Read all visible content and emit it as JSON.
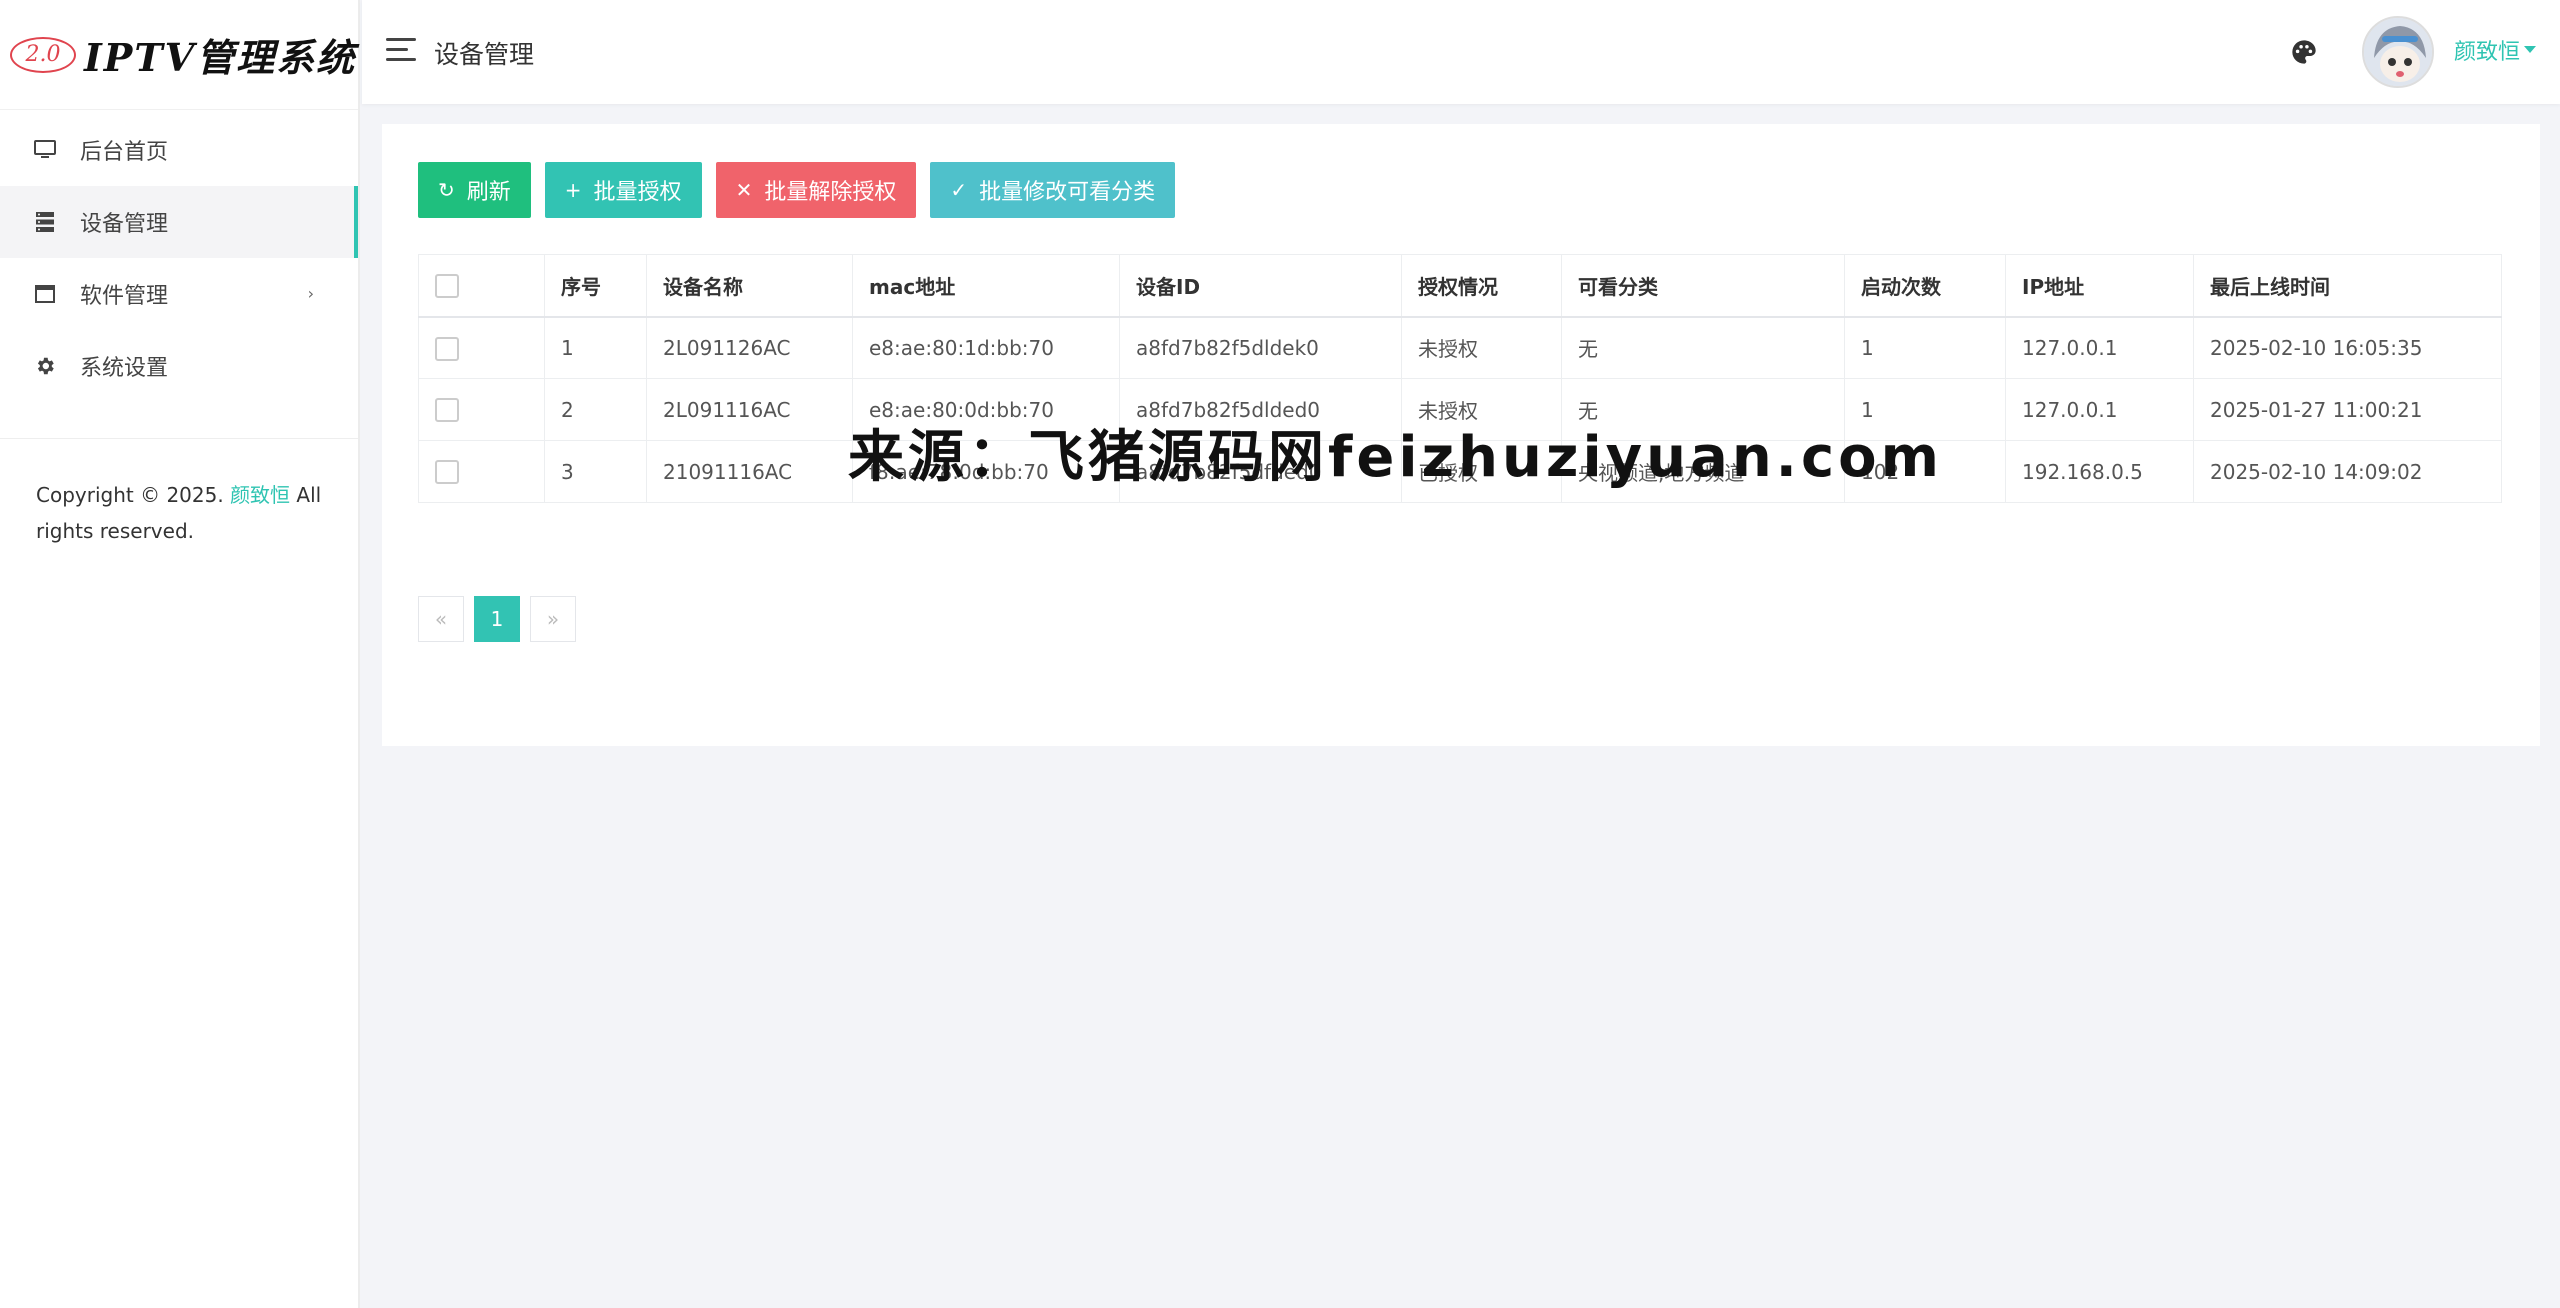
{
  "brand": {
    "badge": "2.0",
    "title": "IPTV管理系统"
  },
  "sidebar": {
    "items": [
      {
        "label": "后台首页",
        "icon": "monitor-icon"
      },
      {
        "label": "设备管理",
        "icon": "server-icon",
        "active": true
      },
      {
        "label": "软件管理",
        "icon": "window-icon",
        "chevron": "›"
      },
      {
        "label": "系统设置",
        "icon": "gear-icon"
      }
    ],
    "copyright_prefix": "Copyright © 2025. ",
    "copyright_author": "颜致恒",
    "copyright_suffix": " All rights reserved."
  },
  "header": {
    "page_title": "设备管理",
    "username": "颜致恒"
  },
  "toolbar": {
    "refresh": {
      "icon": "↻",
      "label": "刷新"
    },
    "batch_auth": {
      "icon": "+",
      "label": "批量授权"
    },
    "batch_unauth": {
      "icon": "✕",
      "label": "批量解除授权"
    },
    "batch_category": {
      "icon": "✓",
      "label": "批量修改可看分类"
    }
  },
  "table": {
    "columns": [
      "序号",
      "设备名称",
      "mac地址",
      "设备ID",
      "授权情况",
      "可看分类",
      "启动次数",
      "IP地址",
      "最后上线时间"
    ],
    "rows": [
      {
        "index": "1",
        "name": "2L091126AC",
        "mac": "e8:ae:80:1d:bb:70",
        "device_id": "a8fd7b82f5dldek0",
        "status": "未授权",
        "category": "无",
        "launches": "1",
        "ip": "127.0.0.1",
        "last_online": "2025-02-10 16:05:35"
      },
      {
        "index": "2",
        "name": "2L091116AC",
        "mac": "e8:ae:80:0d:bb:70",
        "device_id": "a8fd7b82f5dlded0",
        "status": "未授权",
        "category": "无",
        "launches": "1",
        "ip": "127.0.0.1",
        "last_online": "2025-01-27 11:00:21"
      },
      {
        "index": "3",
        "name": "21091116AC",
        "mac": "f8:ae:78:0d:bb:70",
        "device_id": "a8fd7b82f5dfded0",
        "status": "已授权",
        "category": "央视频道,地方频道",
        "launches": "102",
        "ip": "192.168.0.5",
        "last_online": "2025-02-10 14:09:02"
      }
    ]
  },
  "pagination": {
    "prev": "«",
    "current": "1",
    "next": "»"
  },
  "watermark": "来源：飞猪源码网feizhuziyuan.com",
  "colors": {
    "accent": "#2fc4b2",
    "green": "#1fbf7e",
    "red": "#f0636b",
    "cyan": "#4fc1cb",
    "orange": "#f5a13a"
  }
}
